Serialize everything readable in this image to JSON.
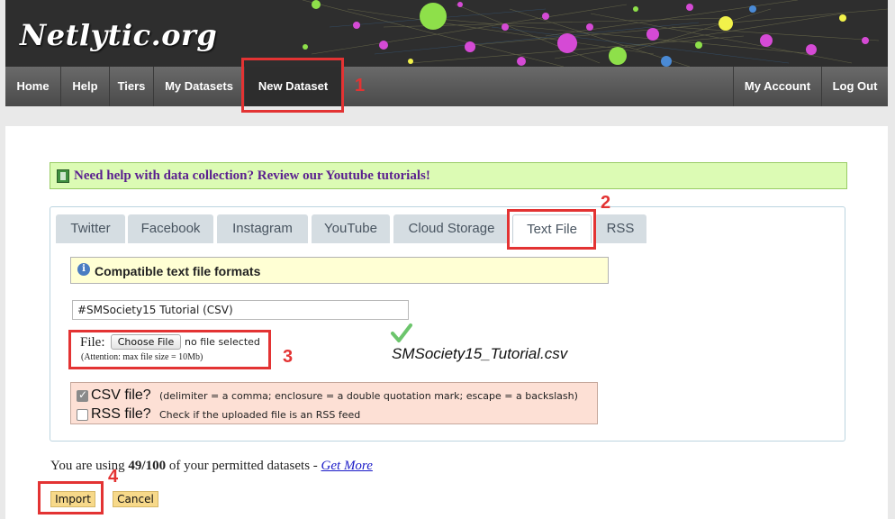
{
  "header": {
    "logo": "Netlytic.org"
  },
  "nav": {
    "home": "Home",
    "help": "Help",
    "tiers": "Tiers",
    "my_datasets": "My Datasets",
    "new_dataset": "New Dataset",
    "my_account": "My Account",
    "log_out": "Log Out"
  },
  "annotations": {
    "n1": "1",
    "n2": "2",
    "n3": "3",
    "n4": "4"
  },
  "help_banner": {
    "text": "Need help with data collection? Review our Youtube tutorials!"
  },
  "tabs": {
    "twitter": "Twitter",
    "facebook": "Facebook",
    "instagram": "Instagram",
    "youtube": "YouTube",
    "cloud_storage": "Cloud Storage",
    "text_file": "Text File",
    "rss": "RSS",
    "active": "Text File"
  },
  "info": {
    "title": "Compatible text file formats",
    "icon": "info-icon"
  },
  "dataset_name": {
    "value": "#SMSociety15 Tutorial (CSV)"
  },
  "file": {
    "label": "File:",
    "choose_button": "Choose File",
    "status": "no file selected",
    "attention": "(Attention: max file size = 10Mb)",
    "uploaded_name": "SMSociety15_Tutorial.csv"
  },
  "options": {
    "csv_title": "CSV file?",
    "csv_desc": "(delimiter = a comma; enclosure = a double quotation mark; escape = a backslash)",
    "csv_checked": true,
    "rss_title": "RSS file?",
    "rss_desc": "Check if the uploaded file is an RSS feed",
    "rss_checked": false
  },
  "usage": {
    "prefix": "You are using",
    "count": "49/100",
    "suffix": "of your permitted datasets -",
    "link": "Get More"
  },
  "buttons": {
    "import": "Import",
    "cancel": "Cancel"
  },
  "colors": {
    "accent_red": "#e33333",
    "banner_green": "#dcfbb4",
    "banner_text": "#5a1f8f",
    "options_bg": "#fde0d5",
    "button_yellow": "#f7d98a"
  }
}
